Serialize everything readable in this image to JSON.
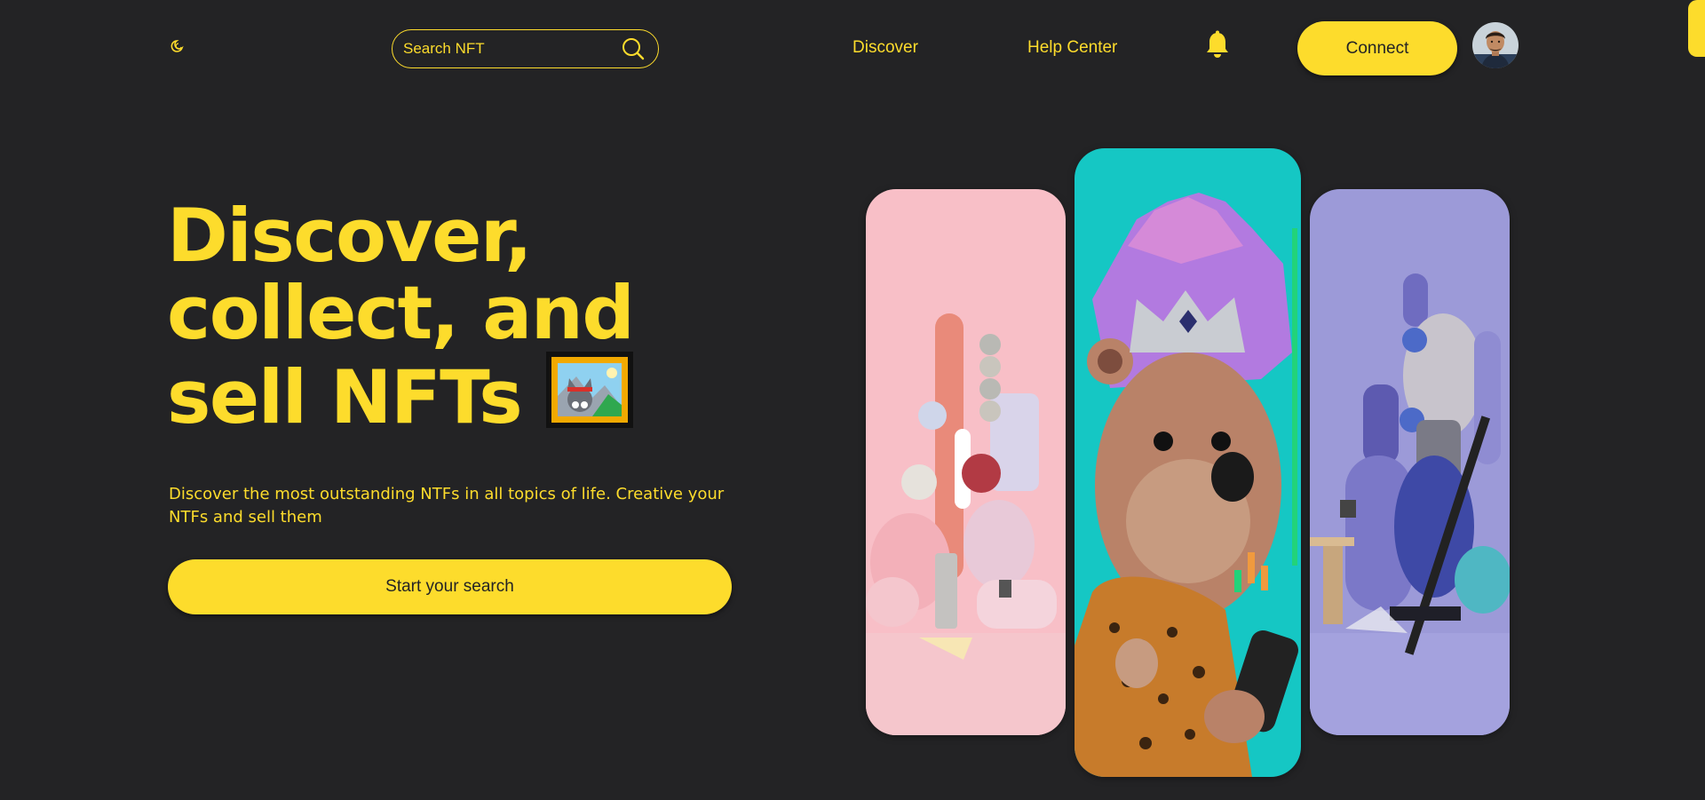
{
  "header": {
    "logo_icon": "moon-icon",
    "search": {
      "placeholder": "Search NFT",
      "icon": "search-icon"
    },
    "nav": [
      {
        "label": "Discover"
      },
      {
        "label": "Help Center"
      }
    ],
    "notification_icon": "bell-icon",
    "connect_label": "Connect",
    "avatar_icon": "avatar"
  },
  "hero": {
    "title_lines": [
      "Discover,",
      "collect, and",
      "sell NFTs"
    ],
    "title_icon": "framed-picture-icon",
    "description": "Discover the most outstanding NTFs in all topics of life. Creative your NTFs and sell them",
    "cta_label": "Start your search"
  },
  "cards": [
    {
      "name": "nft-card-pink-abstract",
      "background": "#f8bfc7"
    },
    {
      "name": "nft-card-bear-king",
      "background": "#15c7c4"
    },
    {
      "name": "nft-card-purple-abstract",
      "background": "#9c9ad8"
    }
  ],
  "colors": {
    "background": "#232325",
    "accent": "#fddc2c",
    "button_text": "#232325"
  }
}
